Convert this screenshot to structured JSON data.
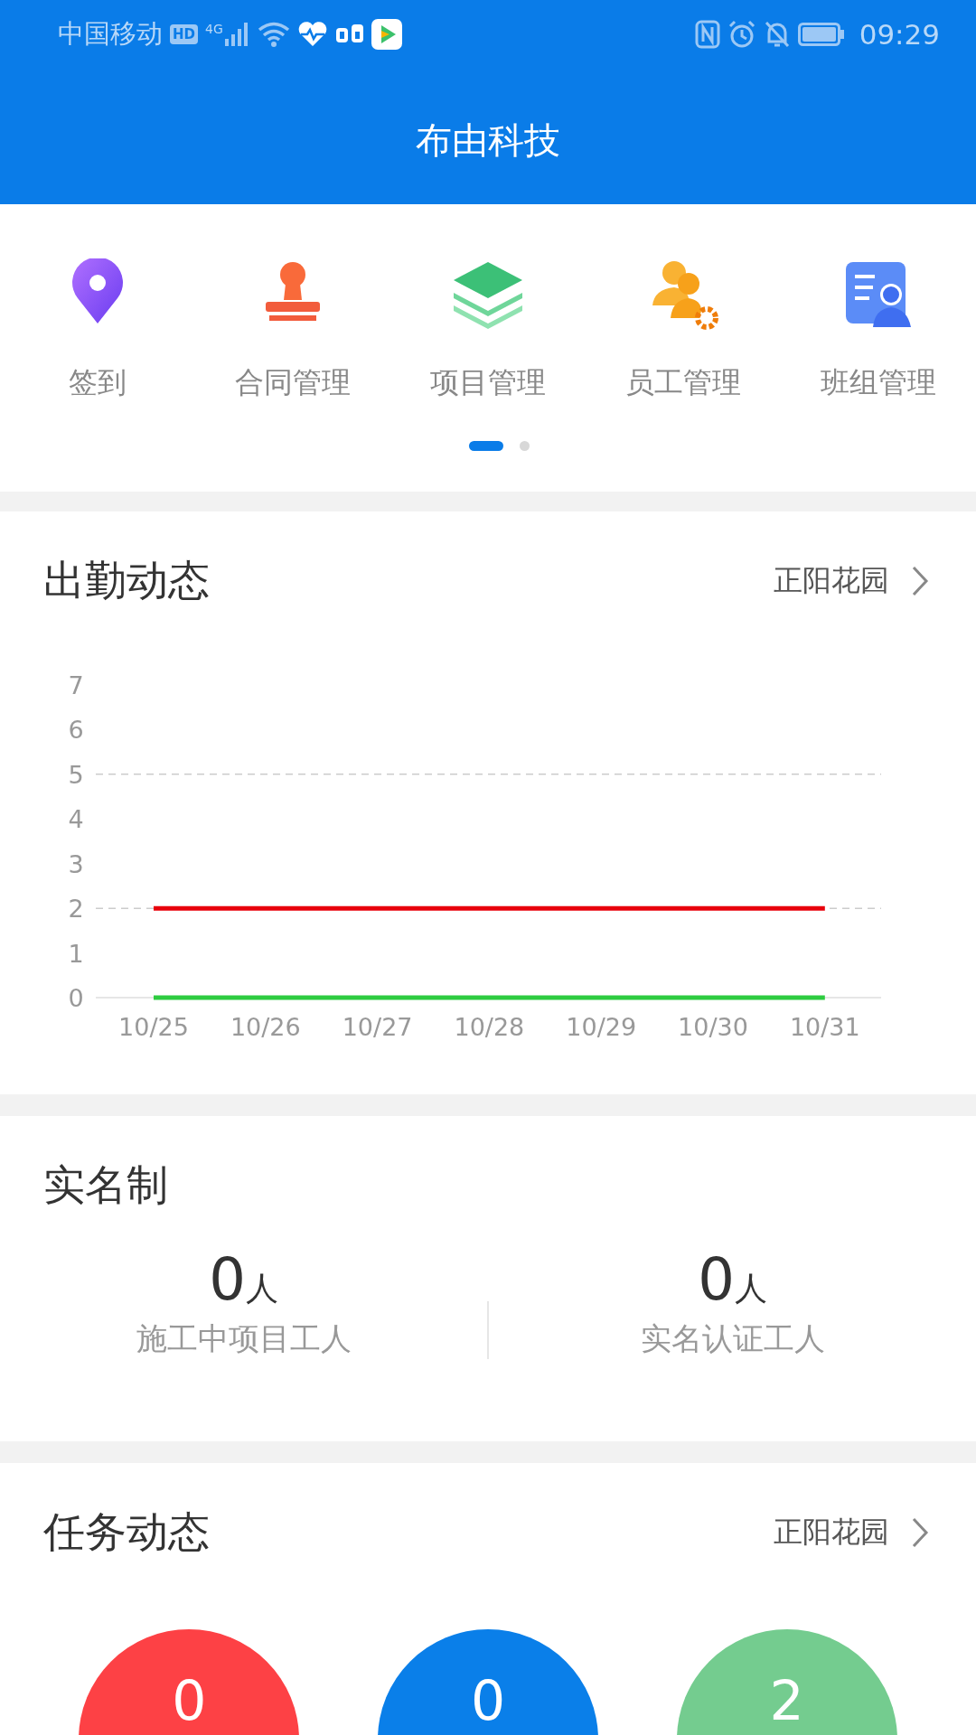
{
  "status_bar": {
    "carrier": "中国移动",
    "hd": "HD",
    "network": "4G",
    "time": "09:29"
  },
  "header": {
    "title": "布由科技"
  },
  "shortcuts": [
    {
      "label": "签到",
      "kind": "pin"
    },
    {
      "label": "合同管理",
      "kind": "stamp"
    },
    {
      "label": "项目管理",
      "kind": "layers"
    },
    {
      "label": "员工管理",
      "kind": "staff"
    },
    {
      "label": "班组管理",
      "kind": "team"
    }
  ],
  "pager": [
    {
      "selected": true
    },
    {
      "selected": false
    }
  ],
  "attendance": {
    "title": "出勤动态",
    "project": "正阳花园",
    "chart_data": {
      "type": "line",
      "categories": [
        "10/25",
        "10/26",
        "10/27",
        "10/28",
        "10/29",
        "10/30",
        "10/31"
      ],
      "ylim": [
        0,
        7
      ],
      "yticks": [
        0,
        1,
        2,
        3,
        4,
        5,
        6,
        7
      ],
      "series": [
        {
          "color": "#e8000b",
          "values": [
            2,
            2,
            2,
            2,
            2,
            2,
            2
          ]
        },
        {
          "color": "#2ecc40",
          "values": [
            0,
            0,
            0,
            0,
            0,
            0,
            0
          ]
        }
      ]
    }
  },
  "real_name": {
    "title": "实名制",
    "stats": [
      {
        "value": "0",
        "unit": "人",
        "label": "施工中项目工人"
      },
      {
        "value": "0",
        "unit": "人",
        "label": "实名认证工人"
      }
    ]
  },
  "tasks": {
    "title": "任务动态",
    "project": "正阳花园",
    "circles": [
      {
        "value": "0",
        "color": "#fd4145"
      },
      {
        "value": "0",
        "color": "#0a7fe9"
      },
      {
        "value": "2",
        "color": "#74cc8f"
      }
    ]
  }
}
